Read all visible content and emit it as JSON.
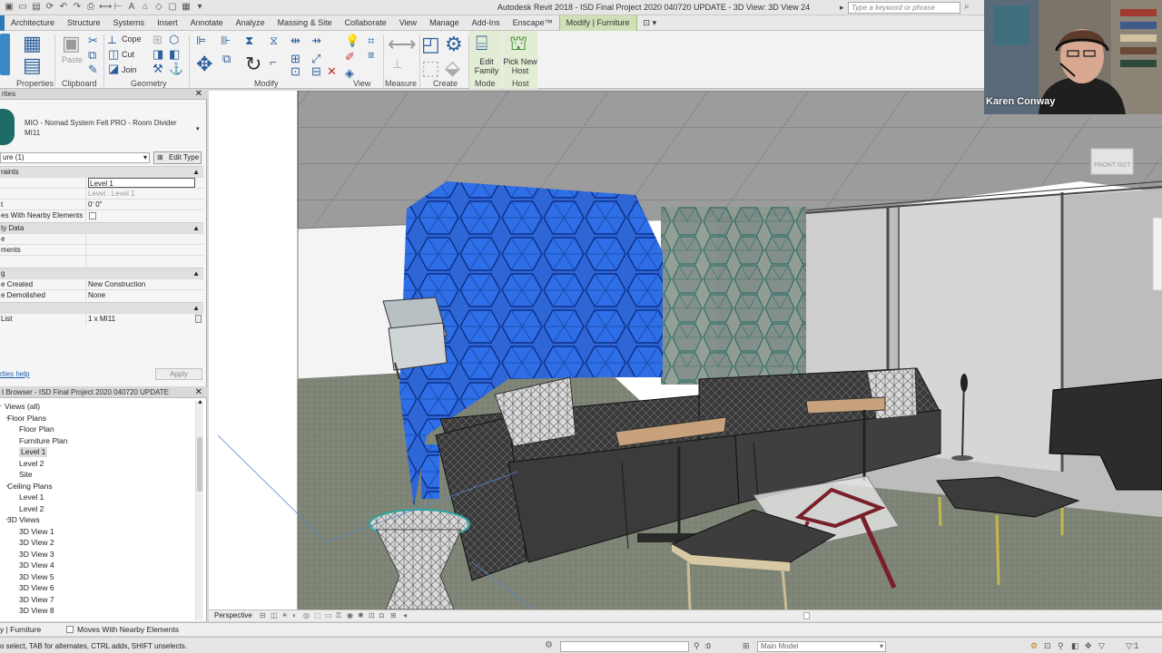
{
  "window": {
    "title": "Autodesk Revit 2018 -  ISD Final Project 2020 040720  UPDATE - 3D View: 3D View 24",
    "search_placeholder": "Type a keyword or phrase"
  },
  "ribbon": {
    "tabs": [
      "Architecture",
      "Structure",
      "Systems",
      "Insert",
      "Annotate",
      "Analyze",
      "Massing & Site",
      "Collaborate",
      "View",
      "Manage",
      "Add-Ins",
      "Enscape™",
      "Modify | Furniture"
    ],
    "active_tab": "Modify | Furniture",
    "panels": [
      "Properties",
      "Clipboard",
      "Geometry",
      "Modify",
      "View",
      "Measure",
      "Create",
      "Mode",
      "Host"
    ],
    "tools": {
      "cope": "Cope",
      "cut": "Cut",
      "join": "Join",
      "paste": "Paste",
      "edit_family": "Edit Family",
      "pick_new_host": "Pick New Host"
    }
  },
  "properties": {
    "type_name": "MIO - Nomad System Felt PRO - Room Divider MI11",
    "instance_filter": "ure (1)",
    "edit_type_label": "Edit Type",
    "groups": {
      "constraints": "raints",
      "identity": "ty Data",
      "phasing": "g"
    },
    "rows": {
      "level_key": "",
      "level_val": "Level 1",
      "host_key": "",
      "host_val": "Level : Level 1",
      "offset_key": "t",
      "offset_val": "0'  0\"",
      "moves_key": "es With Nearby Elements",
      "image_key": "e",
      "comments_key": "ments",
      "mark_key": "",
      "phase_created_key": "e Created",
      "phase_created_val": "New Construction",
      "phase_demolished_key": "e Demolished",
      "phase_demolished_val": "None",
      "list_key": "List",
      "list_val": "1 x MI11"
    },
    "help_link": "rties help",
    "apply_label": "Apply"
  },
  "browser": {
    "title": "t Browser - ISD Final Project 2020 040720  UPDATE",
    "items": [
      {
        "label": "Views (all)",
        "level": 0
      },
      {
        "label": "Floor Plans",
        "level": 1
      },
      {
        "label": "Floor Plan",
        "level": 2
      },
      {
        "label": "Furniture Plan",
        "level": 2
      },
      {
        "label": "Level 1",
        "level": 2
      },
      {
        "label": "Level 2",
        "level": 2
      },
      {
        "label": "Site",
        "level": 2
      },
      {
        "label": "Ceiling Plans",
        "level": 1
      },
      {
        "label": "Level 1",
        "level": 2
      },
      {
        "label": "Level 2",
        "level": 2
      },
      {
        "label": "3D Views",
        "level": 1
      },
      {
        "label": "3D View 1",
        "level": 2
      },
      {
        "label": "3D View 2",
        "level": 2
      },
      {
        "label": "3D View 3",
        "level": 2
      },
      {
        "label": "3D View 4",
        "level": 2
      },
      {
        "label": "3D View 5",
        "level": 2
      },
      {
        "label": "3D View 6",
        "level": 2
      },
      {
        "label": "3D View 7",
        "level": 2
      },
      {
        "label": "3D View 8",
        "level": 2
      }
    ],
    "selected_index": 4
  },
  "viewport": {
    "viewcube_label": "FRONT  RGT",
    "view_style": "Perspective"
  },
  "options_bar": {
    "context": "y | Furniture",
    "moves_with_nearby": "Moves With Nearby Elements"
  },
  "status": {
    "hint": "o select, TAB for alternates, CTRL adds, SHIFT unselects.",
    "zero": ":0",
    "model": "Main Model"
  },
  "webcam": {
    "name": "Karen Conway"
  },
  "colors": {
    "selection_blue": "#2f6fe0",
    "teal_panels": "#2e6f6b",
    "modify_tab_green": "#cfe0b9"
  }
}
